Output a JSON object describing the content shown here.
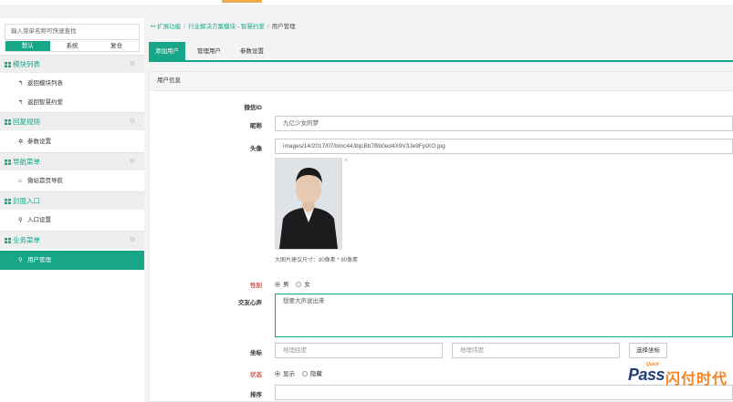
{
  "sidebar": {
    "search_placeholder": "输入菜单名称可快速查找",
    "mode_tabs": [
      "默认",
      "系统",
      "复合"
    ],
    "sections": [
      {
        "title": "模块列表",
        "items": [
          "返回模块列表",
          "返回智慧约爱"
        ]
      },
      {
        "title": "回复规则",
        "items": [
          "参数设置"
        ]
      },
      {
        "title": "导航菜单",
        "items": [
          "微站首页导航"
        ]
      },
      {
        "title": "封面入口",
        "items": [
          "入口设置"
        ]
      },
      {
        "title": "业务菜单",
        "items": [
          "用户管理"
        ]
      }
    ]
  },
  "breadcrumb": {
    "items": [
      "扩展功能",
      "行业解决方案模块 - 智慧约爱",
      "用户管理"
    ]
  },
  "tabs": [
    "添加用户",
    "管理用户",
    "参数设置"
  ],
  "panel": {
    "title": "用户信息",
    "fields": {
      "wechat_id_label": "微信ID",
      "nickname_label": "昵称",
      "nickname_value": "九亿少女的梦",
      "avatar_label": "头像",
      "avatar_value": "images/14/2017/07/bmc443bjcBb7Bb0ed4X9V3Je9FpiXO.jpg",
      "avatar_hint": "大图片建议尺寸：80像素 * 80像素",
      "avatar_close": "×",
      "gender_label": "性别",
      "gender_options": [
        "男",
        "女"
      ],
      "motto_label": "交友心声",
      "motto_value": "想要大声说出来",
      "coords_label": "坐标",
      "longitude_placeholder": "地理经度",
      "latitude_placeholder": "地理纬度",
      "select_coords_button": "选择坐标",
      "status_label": "状态",
      "status_options": [
        "显示",
        "隐藏"
      ],
      "sort_label": "排序"
    }
  },
  "watermark": {
    "pass": "Pass",
    "quick": "Quick",
    "cn": "闪付时代"
  },
  "colors": {
    "accent": "#18a689",
    "required_label": "#d9534f",
    "logo_blue": "#1f3f7a",
    "logo_orange": "#f58220"
  },
  "icons": {
    "grid": "grid-icon",
    "gear": "gear-icon",
    "back": "back-arrow-icon",
    "settings": "settings-icon",
    "home": "home-icon",
    "user": "user-icon",
    "share": "share-icon"
  }
}
